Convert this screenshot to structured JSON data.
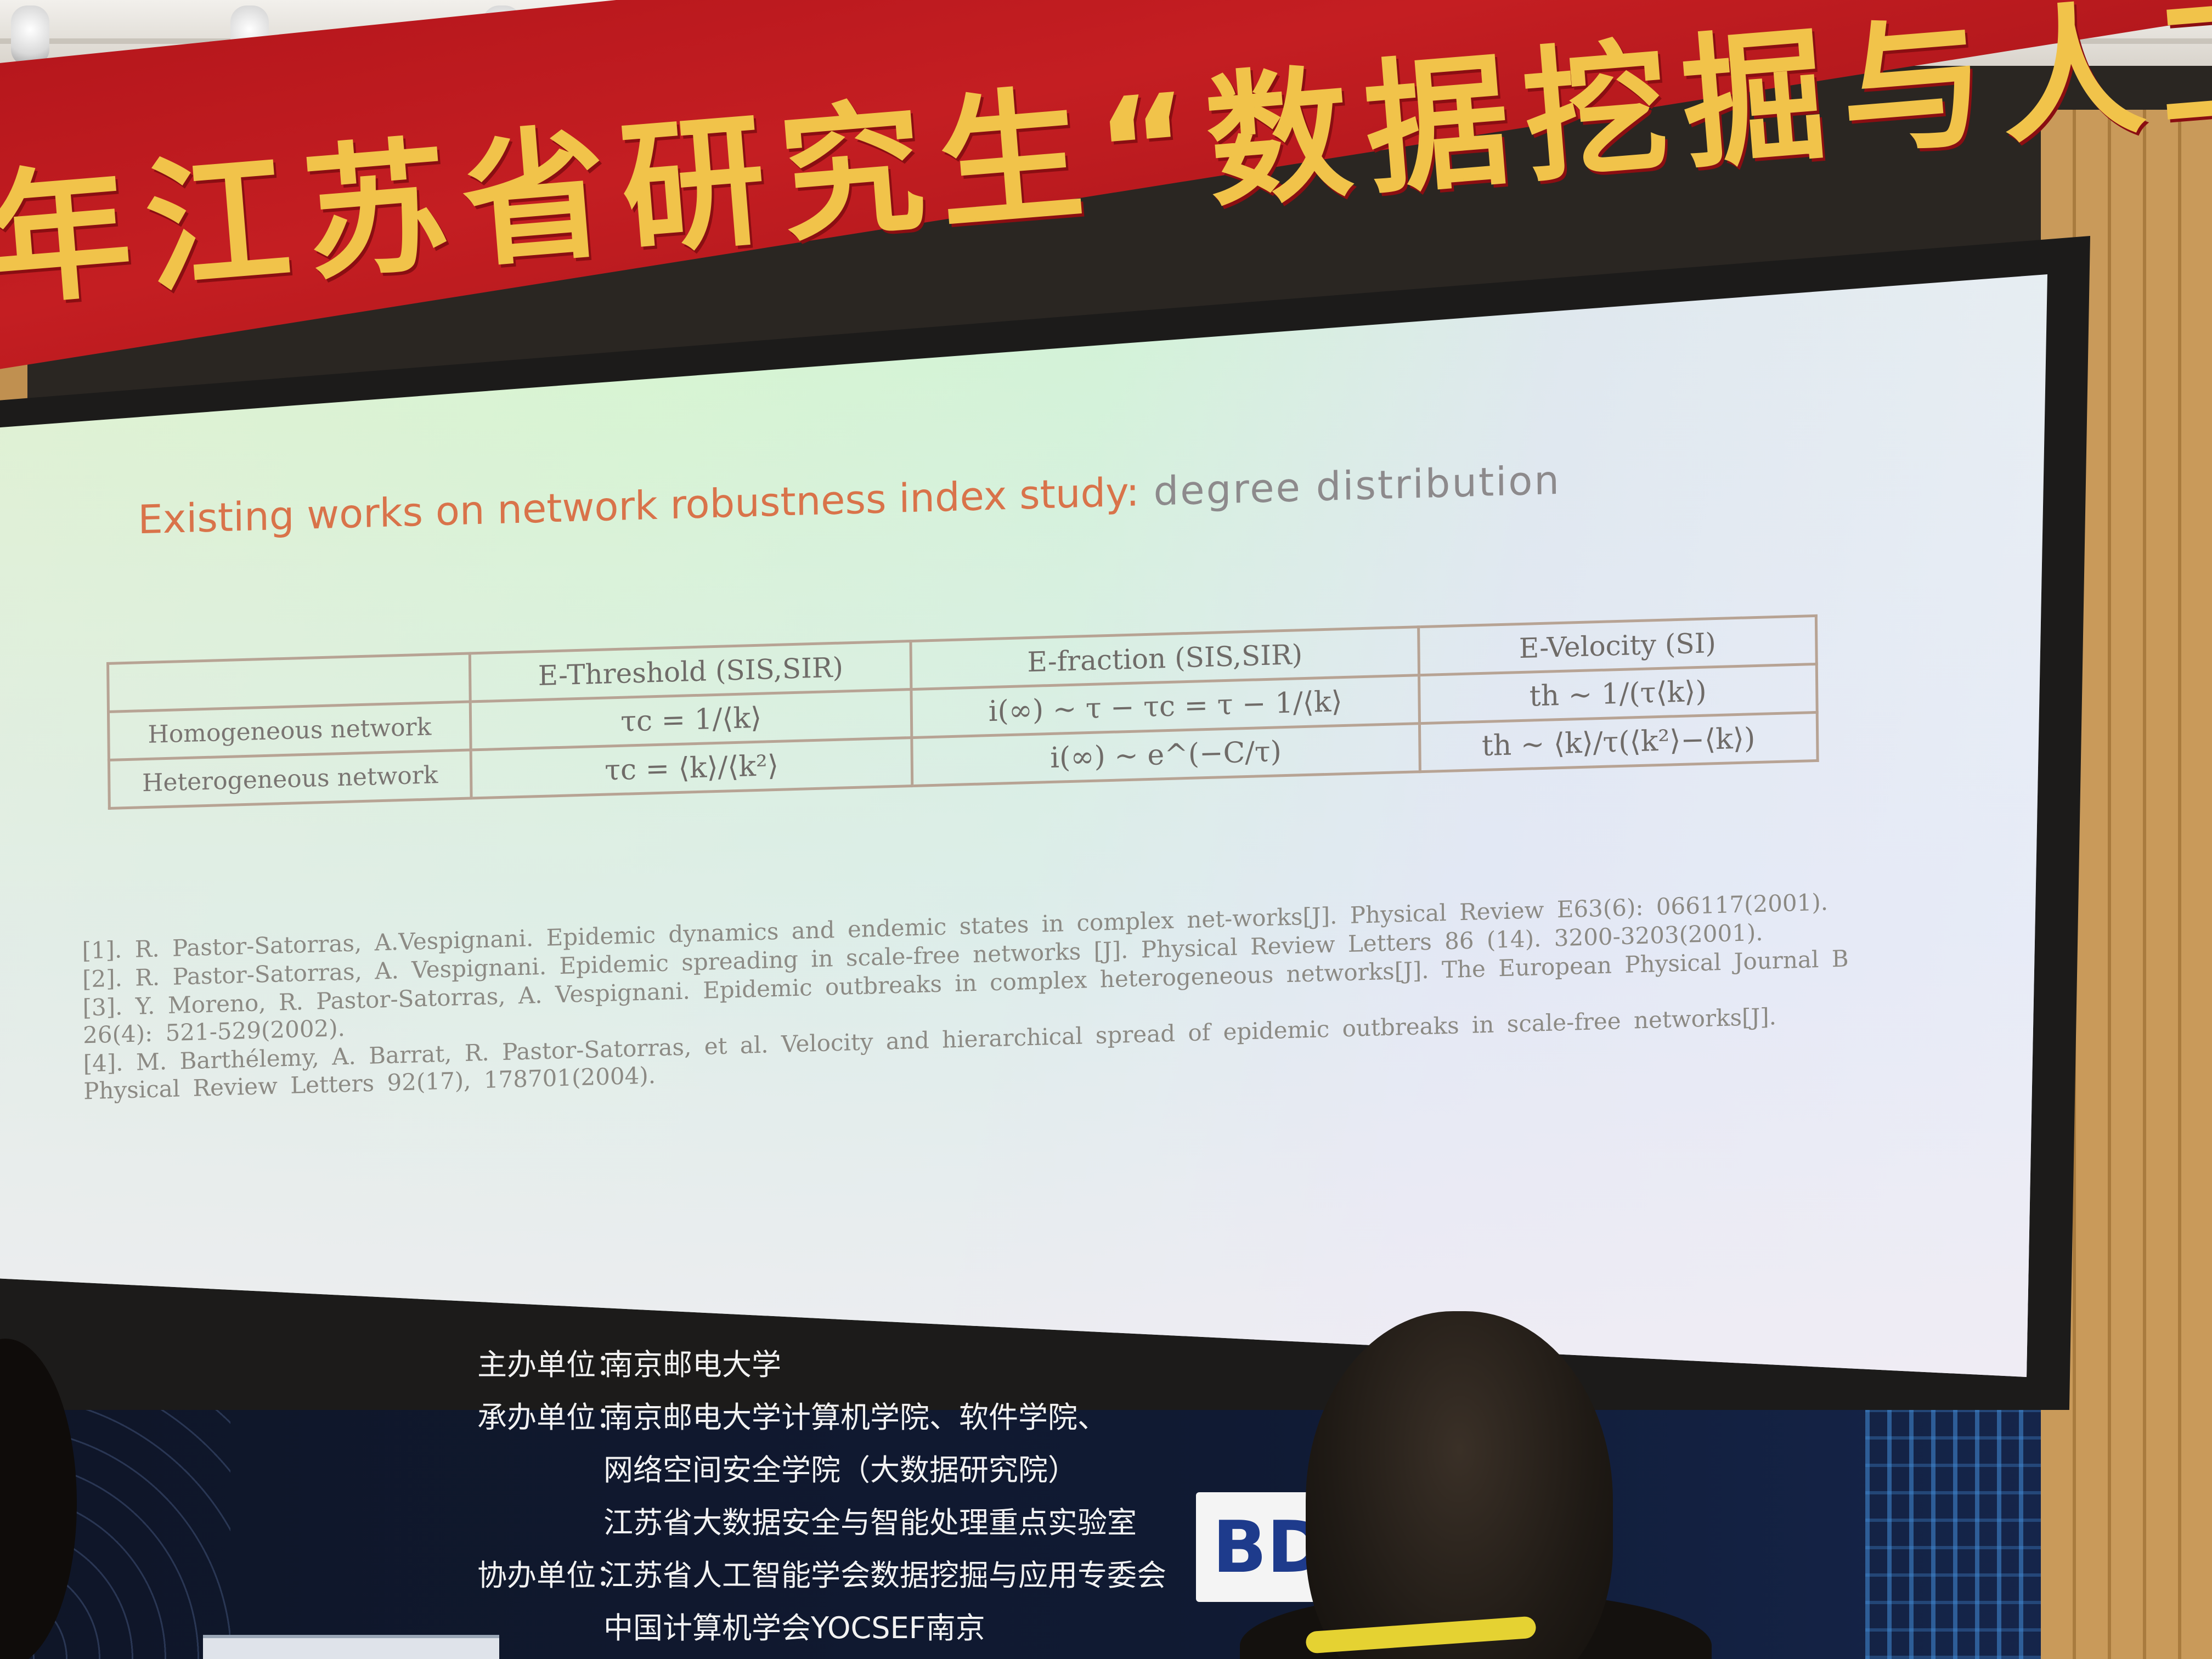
{
  "banner": {
    "text": "年江苏省研究生“数据挖掘与人工智能”暑期学校"
  },
  "slide": {
    "title_part1": "Existing works on network robustness index study:",
    "title_part2": " degree distribution",
    "table": {
      "headers": [
        "",
        "E-Threshold (SIS,SIR)",
        "E-fraction (SIS,SIR)",
        "E-Velocity (SI)"
      ],
      "rows": [
        {
          "label": "Homogeneous network",
          "threshold": "τc = 1/⟨k⟩",
          "fraction": "i(∞) ~ τ − τc = τ − 1/⟨k⟩",
          "velocity": "th ~ 1/(τ⟨k⟩)"
        },
        {
          "label": "Heterogeneous network",
          "threshold": "τc = ⟨k⟩/⟨k²⟩",
          "fraction": "i(∞) ~ e^(−C/τ)",
          "velocity": "th ~ ⟨k⟩/τ(⟨k²⟩−⟨k⟩)"
        }
      ]
    },
    "references": [
      "[1]. R. Pastor-Satorras, A.Vespignani. Epidemic dynamics and endemic states in complex net-works[J]. Physical Review E63(6): 066117(2001).",
      "[2]. R. Pastor-Satorras, A. Vespignani. Epidemic spreading in scale-free networks [J]. Physical Review Letters 86 (14). 3200-3203(2001).",
      "[3]. Y. Moreno, R. Pastor-Satorras, A. Vespignani. Epidemic outbreaks in complex heterogeneous networks[J]. The European Physical Journal B 26(4): 521-529(2002).",
      "[4]. M. Barthélemy, A. Barrat, R. Pastor-Satorras, et al. Velocity and hierarchical spread of epidemic outbreaks in scale-free networks[J]. Physical Review Letters 92(17), 178701(2004)."
    ]
  },
  "board": {
    "host_label": "主办单位：",
    "host": "南京邮电大学",
    "organizer_label": "承办单位：",
    "organizer_lines": [
      "南京邮电大学计算机学院、软件学院、",
      "网络空间安全学院（大数据研究院）",
      "江苏省大数据安全与智能处理重点实验室"
    ],
    "coorganizer_label": "协办单位：",
    "coorganizer_lines": [
      "江苏省人工智能学会数据挖掘与应用专委会",
      "中国计算机学会YOCSEF南京"
    ],
    "logo_text": "BD"
  }
}
